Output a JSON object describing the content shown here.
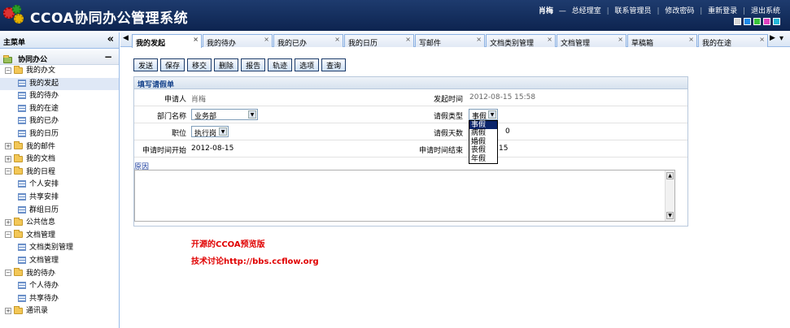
{
  "app": {
    "title": "CCOA协同办公管理系统",
    "user_name": "肖梅",
    "dash": "—",
    "user_role": "总经理室",
    "nav": [
      "联系管理员",
      "修改密码",
      "重新登录",
      "退出系统"
    ],
    "skin_colors": [
      "#d7d7d7",
      "#1e88e5",
      "#3ac43a",
      "#e040c0",
      "#22b8d8"
    ]
  },
  "sidebar": {
    "title": "主菜单",
    "collapse_icon": "«",
    "group": "协同办公",
    "group_toggle": "−",
    "tree": [
      {
        "label": "我的办文",
        "type": "folder",
        "expanded": true,
        "level": 0
      },
      {
        "label": "我的发起",
        "type": "leaf",
        "level": 1,
        "selected": true
      },
      {
        "label": "我的待办",
        "type": "leaf",
        "level": 1
      },
      {
        "label": "我的在途",
        "type": "leaf",
        "level": 1
      },
      {
        "label": "我的已办",
        "type": "leaf",
        "level": 1
      },
      {
        "label": "我的日历",
        "type": "leaf",
        "level": 1
      },
      {
        "label": "我的邮件",
        "type": "folder",
        "expanded": false,
        "level": 0
      },
      {
        "label": "我的文档",
        "type": "folder",
        "expanded": false,
        "level": 0
      },
      {
        "label": "我的日程",
        "type": "folder",
        "expanded": true,
        "level": 0
      },
      {
        "label": "个人安排",
        "type": "leaf",
        "level": 1
      },
      {
        "label": "共享安排",
        "type": "leaf",
        "level": 1
      },
      {
        "label": "群组日历",
        "type": "leaf",
        "level": 1
      },
      {
        "label": "公共信息",
        "type": "folder",
        "expanded": false,
        "level": 0
      },
      {
        "label": "文档管理",
        "type": "folder",
        "expanded": true,
        "level": 0
      },
      {
        "label": "文档类别管理",
        "type": "leaf",
        "level": 1
      },
      {
        "label": "文档管理",
        "type": "leaf",
        "level": 1
      },
      {
        "label": "我的待办",
        "type": "folder",
        "expanded": true,
        "level": 0
      },
      {
        "label": "个人待办",
        "type": "leaf",
        "level": 1
      },
      {
        "label": "共享待办",
        "type": "leaf",
        "level": 1
      },
      {
        "label": "通讯录",
        "type": "folder",
        "expanded": false,
        "level": 0
      }
    ]
  },
  "tabs": {
    "scroll_left": "◀",
    "scroll_right": "▶",
    "menu": "▾",
    "close": "×",
    "items": [
      {
        "label": "我的发起",
        "active": true
      },
      {
        "label": "我的待办"
      },
      {
        "label": "我的已办"
      },
      {
        "label": "我的日历"
      },
      {
        "label": "写邮件"
      },
      {
        "label": "文档类别管理"
      },
      {
        "label": "文档管理"
      },
      {
        "label": "草稿箱"
      },
      {
        "label": "我的在途"
      }
    ]
  },
  "toolbar": {
    "buttons": [
      "发送",
      "保存",
      "移交",
      "删除",
      "报告",
      "轨迹",
      "选项",
      "查询"
    ]
  },
  "form": {
    "title": "填写请假单",
    "applicant_label": "申请人",
    "applicant_value": "肖梅",
    "start_time_label": "发起时间",
    "start_time_value": "2012-08-15 15:58",
    "dept_label": "部门名称",
    "dept_value": "业务部",
    "leave_type_label": "请假类型",
    "leave_type_value": "事假",
    "position_label": "职位",
    "position_value": "执行岗",
    "days_label": "请假天数",
    "days_value": "0",
    "req_start_label": "申请时间开始",
    "req_start_value": "2012-08-15",
    "req_end_label": "申请时间结束",
    "req_end_value": "15",
    "reason_link": "原因",
    "leave_type_options": [
      "事假",
      "病假",
      "婚假",
      "丧假",
      "年假"
    ],
    "select_arrow": "▼",
    "scroll_up": "▲",
    "scroll_down": "▼"
  },
  "promo": {
    "line1": "开源的CCOA预览版",
    "line2": "技术讨论http://bbs.ccflow.org"
  }
}
